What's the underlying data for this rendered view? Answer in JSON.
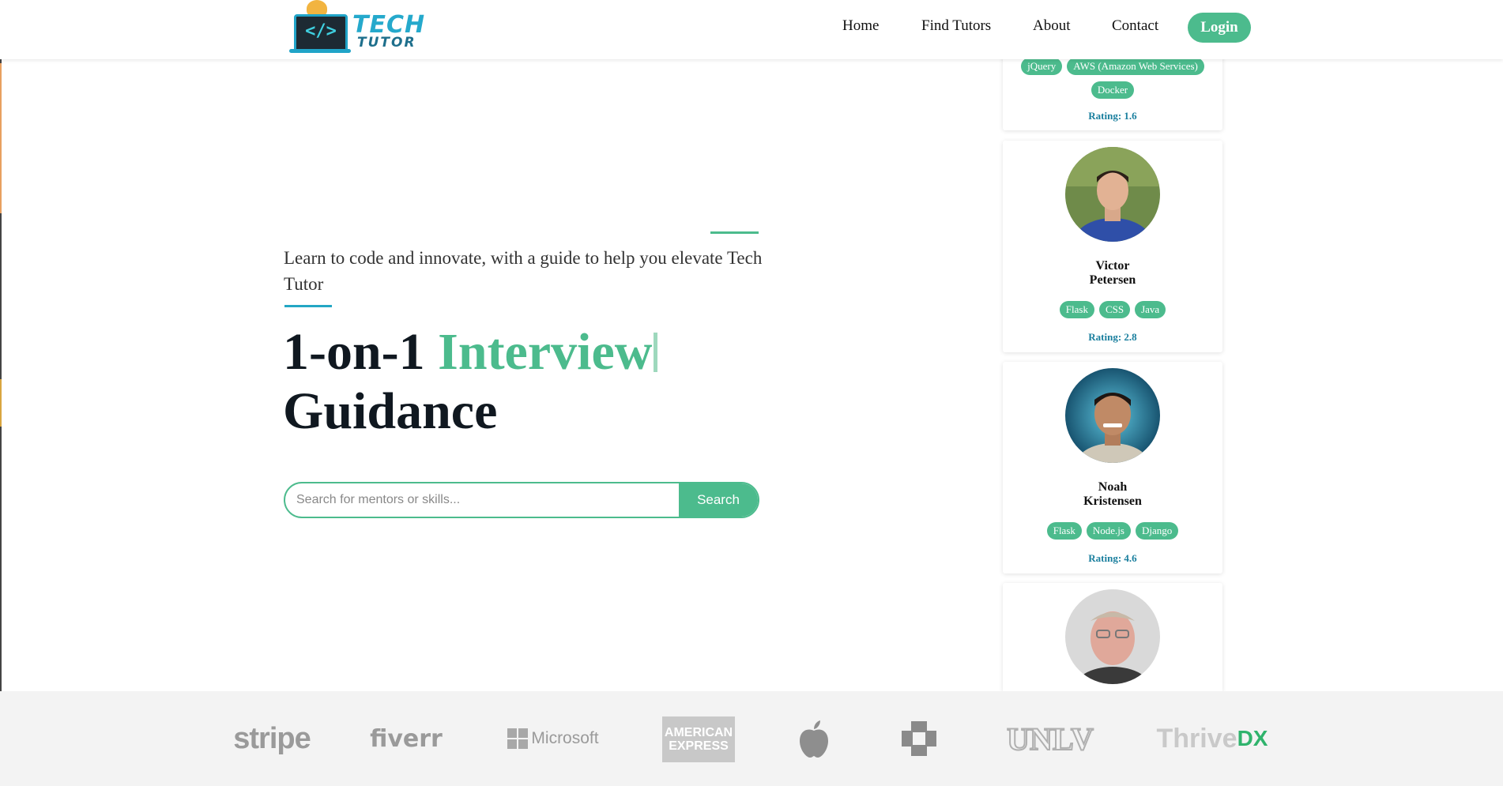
{
  "nav": {
    "logo_line1": "TECH",
    "logo_line2": "TUTOR",
    "logo_code": "</>",
    "links": [
      "Home",
      "Find Tutors",
      "About",
      "Contact"
    ],
    "login": "Login"
  },
  "hero": {
    "subtitle": "Learn to code and innovate, with a guide to help you elevate Tech Tutor",
    "headline_prefix": "1-on-1",
    "headline_accent": "Interview",
    "headline_suffix": "Guidance",
    "search_placeholder": "Search for mentors or skills...",
    "search_button": "Search"
  },
  "tutors": [
    {
      "name_first": "",
      "name_last": "",
      "skills": [
        "jQuery",
        "AWS (Amazon Web Services)",
        "Docker"
      ],
      "rating": "Rating: 1.6"
    },
    {
      "name_first": "Victor",
      "name_last": "Petersen",
      "skills": [
        "Flask",
        "CSS",
        "Java"
      ],
      "rating": "Rating: 2.8"
    },
    {
      "name_first": "Noah",
      "name_last": "Kristensen",
      "skills": [
        "Flask",
        "Node.js",
        "Django"
      ],
      "rating": "Rating: 4.6"
    },
    {
      "name_first": "",
      "name_last": "",
      "skills": [],
      "rating": ""
    }
  ],
  "brands": {
    "stripe": "stripe",
    "fiverr": "fiverr",
    "microsoft": "Microsoft",
    "amex_1": "AMERICAN",
    "amex_2": "EXPRESS",
    "unlv": "UNLV",
    "thrive": "Thrive",
    "thrive_dx": "DX"
  },
  "colors": {
    "accent_green": "#4cbb8d",
    "accent_blue": "#1a7f9e",
    "headline_dark": "#101820"
  }
}
